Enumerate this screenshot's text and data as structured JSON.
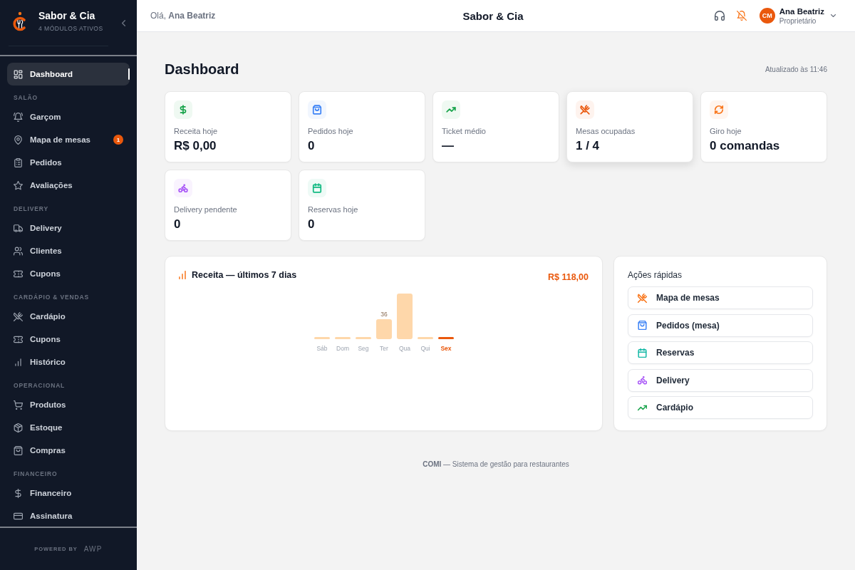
{
  "sidebar": {
    "brand": {
      "name": "Sabor & Cia",
      "subtitle": "4 MÓDULOS ATIVOS"
    },
    "top_item": {
      "label": "Dashboard",
      "selected": true
    },
    "sections": [
      {
        "title": "SALÃO",
        "items": [
          {
            "label": "Garçom",
            "selected": false
          },
          {
            "label": "Mapa de mesas",
            "selected": false,
            "badge": "1"
          },
          {
            "label": "Pedidos",
            "selected": false
          },
          {
            "label": "Avaliações",
            "selected": false
          }
        ]
      },
      {
        "title": "DELIVERY",
        "items": [
          {
            "label": "Delivery",
            "selected": false
          },
          {
            "label": "Clientes",
            "selected": false
          },
          {
            "label": "Cupons",
            "selected": false
          }
        ]
      },
      {
        "title": "CARDÁPIO & VENDAS",
        "items": [
          {
            "label": "Cardápio",
            "selected": false
          },
          {
            "label": "Cupons",
            "selected": false
          },
          {
            "label": "Histórico",
            "selected": false
          }
        ]
      },
      {
        "title": "OPERACIONAL",
        "items": [
          {
            "label": "Produtos",
            "selected": false
          },
          {
            "label": "Estoque",
            "selected": false
          },
          {
            "label": "Compras",
            "selected": false
          }
        ]
      },
      {
        "title": "FINANCEIRO",
        "items": [
          {
            "label": "Financeiro",
            "selected": false
          },
          {
            "label": "Assinatura",
            "selected": false
          }
        ]
      }
    ],
    "footer": {
      "label": "POWERED BY",
      "logo": "AWP"
    }
  },
  "header": {
    "greeting": "Olá, **Ana Beatriz**",
    "title": "Sabor & Cia",
    "user": {
      "initials": "CM",
      "name": "Ana Beatriz",
      "role": "Proprietário"
    }
  },
  "page": {
    "title": "Dashboard",
    "updated": "Atualizado às 11:46"
  },
  "stats": [
    {
      "label": "Receita hoje",
      "value": "R$ 0,00",
      "color": "#16a34a",
      "elevated": false
    },
    {
      "label": "Pedidos hoje",
      "value": "0",
      "color": "#3b82f6",
      "elevated": false
    },
    {
      "label": "Ticket médio",
      "value": "—",
      "color": "#16a34a",
      "elevated": false
    },
    {
      "label": "Mesas ocupadas",
      "value": "1 / 4",
      "color": "#ea580c",
      "elevated": true
    },
    {
      "label": "Giro hoje",
      "value": "0 comandas",
      "color": "#f97316",
      "elevated": false
    },
    {
      "label": "Delivery pendente",
      "value": "0",
      "color": "#a855f7",
      "elevated": false
    },
    {
      "label": "Reservas hoje",
      "value": "0",
      "color": "#10b981",
      "elevated": false
    }
  ],
  "revenue_panel": {
    "total": "R$ 118,00",
    "day_states": [
      {
        "selected": false
      },
      {
        "selected": false
      },
      {
        "selected": false
      },
      {
        "selected": false
      },
      {
        "selected": false
      },
      {
        "selected": false
      },
      {
        "selected": true
      }
    ],
    "chart_data": {
      "type": "bar",
      "title": "Receita — últimos 7 dias",
      "categories": [
        "Sáb",
        "Dom",
        "Seg",
        "Ter",
        "Qua",
        "Qui",
        "Sex"
      ],
      "values": [
        0,
        0,
        0,
        36,
        82,
        0,
        0
      ],
      "value_labels": [
        null,
        null,
        null,
        "36",
        null,
        null,
        null
      ]
    }
  },
  "quick_actions": {
    "title": "Ações rápidas",
    "items": [
      {
        "label": "Mapa de mesas",
        "color": "#f97316"
      },
      {
        "label": "Pedidos (mesa)",
        "color": "#3b82f6"
      },
      {
        "label": "Reservas",
        "color": "#14b8a6"
      },
      {
        "label": "Delivery",
        "color": "#a855f7"
      },
      {
        "label": "Cardápio",
        "color": "#16a34a"
      }
    ]
  },
  "footer": "**COMI** — Sistema de gestão para restaurantes"
}
